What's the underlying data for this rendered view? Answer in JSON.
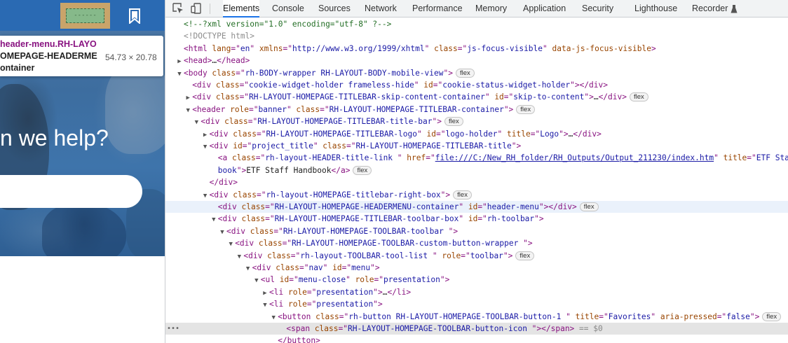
{
  "page": {
    "tooltip": {
      "line1": "header-menu.RH-LAYO",
      "line2": "OMEPAGE-HEADERME",
      "line3": "ontainer",
      "dimensions": "54.73 × 20.78"
    },
    "heading": "n we help?",
    "highlight_label": "------"
  },
  "devtools": {
    "tabs": [
      "Elements",
      "Console",
      "Sources",
      "Network",
      "Performance",
      "Memory",
      "Application",
      "Security",
      "Lighthouse",
      "Recorder"
    ],
    "active_tab": "Elements",
    "accent_color": "#1a73e8",
    "nodes": [
      {
        "depth": 0,
        "arrow": "",
        "parts": [
          [
            "cm",
            "<!--?xml version=\"1.0\" encoding=\"utf-8\" ?-->"
          ]
        ]
      },
      {
        "depth": 0,
        "arrow": "",
        "parts": [
          [
            "dt",
            "<!DOCTYPE html>"
          ]
        ]
      },
      {
        "depth": 0,
        "arrow": "",
        "parts": [
          [
            "tag",
            "<html "
          ],
          [
            "an",
            "lang"
          ],
          [
            "tag",
            "=\""
          ],
          [
            "av",
            "en"
          ],
          [
            "tag",
            "\" "
          ],
          [
            "an",
            "xmlns"
          ],
          [
            "tag",
            "=\""
          ],
          [
            "av",
            "http://www.w3.org/1999/xhtml"
          ],
          [
            "tag",
            "\" "
          ],
          [
            "an",
            "class"
          ],
          [
            "tag",
            "=\""
          ],
          [
            "av",
            "js-focus-visible"
          ],
          [
            "tag",
            "\" "
          ],
          [
            "an",
            "data-js-focus-visible"
          ],
          [
            "tag",
            ">"
          ]
        ]
      },
      {
        "depth": 0,
        "arrow": "right",
        "parts": [
          [
            "tag",
            "<head>"
          ],
          [
            "txt",
            "…"
          ],
          [
            "tag",
            "</head>"
          ]
        ]
      },
      {
        "depth": 0,
        "arrow": "down",
        "parts": [
          [
            "tag",
            "<body "
          ],
          [
            "an",
            "class"
          ],
          [
            "tag",
            "=\""
          ],
          [
            "av",
            "rh-BODY-wrapper RH-LAYOUT-BODY-mobile-view"
          ],
          [
            "tag",
            "\">"
          ]
        ],
        "badge": "flex"
      },
      {
        "depth": 1,
        "arrow": "",
        "parts": [
          [
            "tag",
            "<div "
          ],
          [
            "an",
            "class"
          ],
          [
            "tag",
            "=\""
          ],
          [
            "av",
            "cookie-widget-holder frameless-hide"
          ],
          [
            "tag",
            "\" "
          ],
          [
            "an",
            "id"
          ],
          [
            "tag",
            "=\""
          ],
          [
            "av",
            "cookie-status-widget-holder"
          ],
          [
            "tag",
            "\"></div>"
          ]
        ]
      },
      {
        "depth": 1,
        "arrow": "right",
        "parts": [
          [
            "tag",
            "<div "
          ],
          [
            "an",
            "class"
          ],
          [
            "tag",
            "=\""
          ],
          [
            "av",
            "RH-LAYOUT-HOMEPAGE-TITLEBAR-skip-content-container"
          ],
          [
            "tag",
            "\" "
          ],
          [
            "an",
            "id"
          ],
          [
            "tag",
            "=\""
          ],
          [
            "av",
            "skip-to-content"
          ],
          [
            "tag",
            "\">"
          ],
          [
            "txt",
            "…"
          ],
          [
            "tag",
            "</div>"
          ]
        ],
        "badge": "flex"
      },
      {
        "depth": 1,
        "arrow": "down",
        "parts": [
          [
            "tag",
            "<header "
          ],
          [
            "an",
            "role"
          ],
          [
            "tag",
            "=\""
          ],
          [
            "av",
            "banner"
          ],
          [
            "tag",
            "\" "
          ],
          [
            "an",
            "class"
          ],
          [
            "tag",
            "=\""
          ],
          [
            "av",
            "RH-LAYOUT-HOMEPAGE-TITLEBAR-container"
          ],
          [
            "tag",
            "\">"
          ]
        ],
        "badge": "flex"
      },
      {
        "depth": 2,
        "arrow": "down",
        "parts": [
          [
            "tag",
            "<div "
          ],
          [
            "an",
            "class"
          ],
          [
            "tag",
            "=\""
          ],
          [
            "av",
            "RH-LAYOUT-HOMEPAGE-TITLEBAR-title-bar"
          ],
          [
            "tag",
            "\">"
          ]
        ],
        "badge": "flex"
      },
      {
        "depth": 3,
        "arrow": "right",
        "parts": [
          [
            "tag",
            "<div "
          ],
          [
            "an",
            "class"
          ],
          [
            "tag",
            "=\""
          ],
          [
            "av",
            "RH-LAYOUT-HOMEPAGE-TITLEBAR-logo"
          ],
          [
            "tag",
            "\" "
          ],
          [
            "an",
            "id"
          ],
          [
            "tag",
            "=\""
          ],
          [
            "av",
            "logo-holder"
          ],
          [
            "tag",
            "\" "
          ],
          [
            "an",
            "title"
          ],
          [
            "tag",
            "=\""
          ],
          [
            "av",
            "Logo"
          ],
          [
            "tag",
            "\">"
          ],
          [
            "txt",
            "…"
          ],
          [
            "tag",
            "</div>"
          ]
        ]
      },
      {
        "depth": 3,
        "arrow": "down",
        "parts": [
          [
            "tag",
            "<div "
          ],
          [
            "an",
            "id"
          ],
          [
            "tag",
            "=\""
          ],
          [
            "av",
            "project_title"
          ],
          [
            "tag",
            "\" "
          ],
          [
            "an",
            "class"
          ],
          [
            "tag",
            "=\""
          ],
          [
            "av",
            "RH-LAYOUT-HOMEPAGE-TITLEBAR-title"
          ],
          [
            "tag",
            "\">"
          ]
        ]
      },
      {
        "depth": 4,
        "arrow": "",
        "parts": [
          [
            "tag",
            "<a "
          ],
          [
            "an",
            "class"
          ],
          [
            "tag",
            "=\""
          ],
          [
            "av",
            "rh-layout-HEADER-title-link  "
          ],
          [
            "tag",
            "\" "
          ],
          [
            "an",
            "href"
          ],
          [
            "tag",
            "=\""
          ],
          [
            "link",
            "file:///C:/New_RH_folder/RH_Outputs/Output_211230/index.htm"
          ],
          [
            "tag",
            "\" "
          ],
          [
            "an",
            "title"
          ],
          [
            "tag",
            "=\""
          ],
          [
            "av",
            "ETF Staff"
          ]
        ]
      },
      {
        "depth": 4,
        "arrow": "",
        "parts": [
          [
            "av",
            "book"
          ],
          [
            "tag",
            "\">"
          ],
          [
            "txt",
            "ETF Staff Handbook"
          ],
          [
            "tag",
            "</a>"
          ]
        ],
        "badge": "flex"
      },
      {
        "depth": 3,
        "arrow": "",
        "parts": [
          [
            "tag",
            "</div>"
          ]
        ]
      },
      {
        "depth": 3,
        "arrow": "down",
        "parts": [
          [
            "tag",
            "<div "
          ],
          [
            "an",
            "class"
          ],
          [
            "tag",
            "=\""
          ],
          [
            "av",
            "rh-layout-HOMEPAGE-titlebar-right-box"
          ],
          [
            "tag",
            "\">"
          ]
        ],
        "badge": "flex"
      },
      {
        "depth": 4,
        "arrow": "",
        "hover": true,
        "parts": [
          [
            "tag",
            "<div "
          ],
          [
            "an",
            "class"
          ],
          [
            "tag",
            "=\""
          ],
          [
            "av",
            "RH-LAYOUT-HOMEPAGE-HEADERMENU-container"
          ],
          [
            "tag",
            "\" "
          ],
          [
            "an",
            "id"
          ],
          [
            "tag",
            "=\""
          ],
          [
            "av",
            "header-menu"
          ],
          [
            "tag",
            "\"></div>"
          ]
        ],
        "badge": "flex"
      },
      {
        "depth": 4,
        "arrow": "down",
        "parts": [
          [
            "tag",
            "<div "
          ],
          [
            "an",
            "class"
          ],
          [
            "tag",
            "=\""
          ],
          [
            "av",
            "RH-LAYOUT-HOMEPAGE-TITLEBAR-toolbar-box"
          ],
          [
            "tag",
            "\" "
          ],
          [
            "an",
            "id"
          ],
          [
            "tag",
            "=\""
          ],
          [
            "av",
            "rh-toolbar"
          ],
          [
            "tag",
            "\">"
          ]
        ]
      },
      {
        "depth": 5,
        "arrow": "down",
        "parts": [
          [
            "tag",
            "<div "
          ],
          [
            "an",
            "class"
          ],
          [
            "tag",
            "=\""
          ],
          [
            "av",
            "RH-LAYOUT-HOMEPAGE-TOOLBAR-toolbar "
          ],
          [
            "tag",
            "\">"
          ]
        ]
      },
      {
        "depth": 6,
        "arrow": "down",
        "parts": [
          [
            "tag",
            "<div "
          ],
          [
            "an",
            "class"
          ],
          [
            "tag",
            "=\""
          ],
          [
            "av",
            "RH-LAYOUT-HOMEPAGE-TOOLBAR-custom-button-wrapper "
          ],
          [
            "tag",
            "\">"
          ]
        ]
      },
      {
        "depth": 7,
        "arrow": "down",
        "parts": [
          [
            "tag",
            "<div "
          ],
          [
            "an",
            "class"
          ],
          [
            "tag",
            "=\""
          ],
          [
            "av",
            "rh-layout-TOOLBAR-tool-list  "
          ],
          [
            "tag",
            "\" "
          ],
          [
            "an",
            "role"
          ],
          [
            "tag",
            "=\""
          ],
          [
            "av",
            "toolbar"
          ],
          [
            "tag",
            "\">"
          ]
        ],
        "badge": "flex"
      },
      {
        "depth": 8,
        "arrow": "down",
        "parts": [
          [
            "tag",
            "<div "
          ],
          [
            "an",
            "class"
          ],
          [
            "tag",
            "=\""
          ],
          [
            "av",
            "nav"
          ],
          [
            "tag",
            "\" "
          ],
          [
            "an",
            "id"
          ],
          [
            "tag",
            "=\""
          ],
          [
            "av",
            "menu"
          ],
          [
            "tag",
            "\">"
          ]
        ]
      },
      {
        "depth": 9,
        "arrow": "down",
        "parts": [
          [
            "tag",
            "<ul "
          ],
          [
            "an",
            "id"
          ],
          [
            "tag",
            "=\""
          ],
          [
            "av",
            "menu-close"
          ],
          [
            "tag",
            "\" "
          ],
          [
            "an",
            "role"
          ],
          [
            "tag",
            "=\""
          ],
          [
            "av",
            "presentation"
          ],
          [
            "tag",
            "\">"
          ]
        ]
      },
      {
        "depth": 10,
        "arrow": "right",
        "parts": [
          [
            "tag",
            "<li "
          ],
          [
            "an",
            "role"
          ],
          [
            "tag",
            "=\""
          ],
          [
            "av",
            "presentation"
          ],
          [
            "tag",
            "\">"
          ],
          [
            "txt",
            "…"
          ],
          [
            "tag",
            "</li>"
          ]
        ]
      },
      {
        "depth": 10,
        "arrow": "down",
        "parts": [
          [
            "tag",
            "<li "
          ],
          [
            "an",
            "role"
          ],
          [
            "tag",
            "=\""
          ],
          [
            "av",
            "presentation"
          ],
          [
            "tag",
            "\">"
          ]
        ]
      },
      {
        "depth": 11,
        "arrow": "down",
        "parts": [
          [
            "tag",
            "<button "
          ],
          [
            "an",
            "class"
          ],
          [
            "tag",
            "=\""
          ],
          [
            "av",
            "rh-button RH-LAYOUT-HOMEPAGE-TOOLBAR-button-1  "
          ],
          [
            "tag",
            "\" "
          ],
          [
            "an",
            "title"
          ],
          [
            "tag",
            "=\""
          ],
          [
            "av",
            "Favorites"
          ],
          [
            "tag",
            "\" "
          ],
          [
            "an",
            "aria-pressed"
          ],
          [
            "tag",
            "=\""
          ],
          [
            "av",
            "false"
          ],
          [
            "tag",
            "\">"
          ]
        ],
        "badge": "flex"
      },
      {
        "depth": 12,
        "arrow": "",
        "selected": true,
        "parts": [
          [
            "tag",
            "<span "
          ],
          [
            "an",
            "class"
          ],
          [
            "tag",
            "=\""
          ],
          [
            "av",
            "RH-LAYOUT-HOMEPAGE-TOOLBAR-button-icon  "
          ],
          [
            "tag",
            "\"></span>"
          ],
          [
            "eq",
            " == $0"
          ]
        ]
      },
      {
        "depth": 11,
        "arrow": "",
        "parts": [
          [
            "tag",
            "</button>"
          ]
        ]
      }
    ]
  }
}
